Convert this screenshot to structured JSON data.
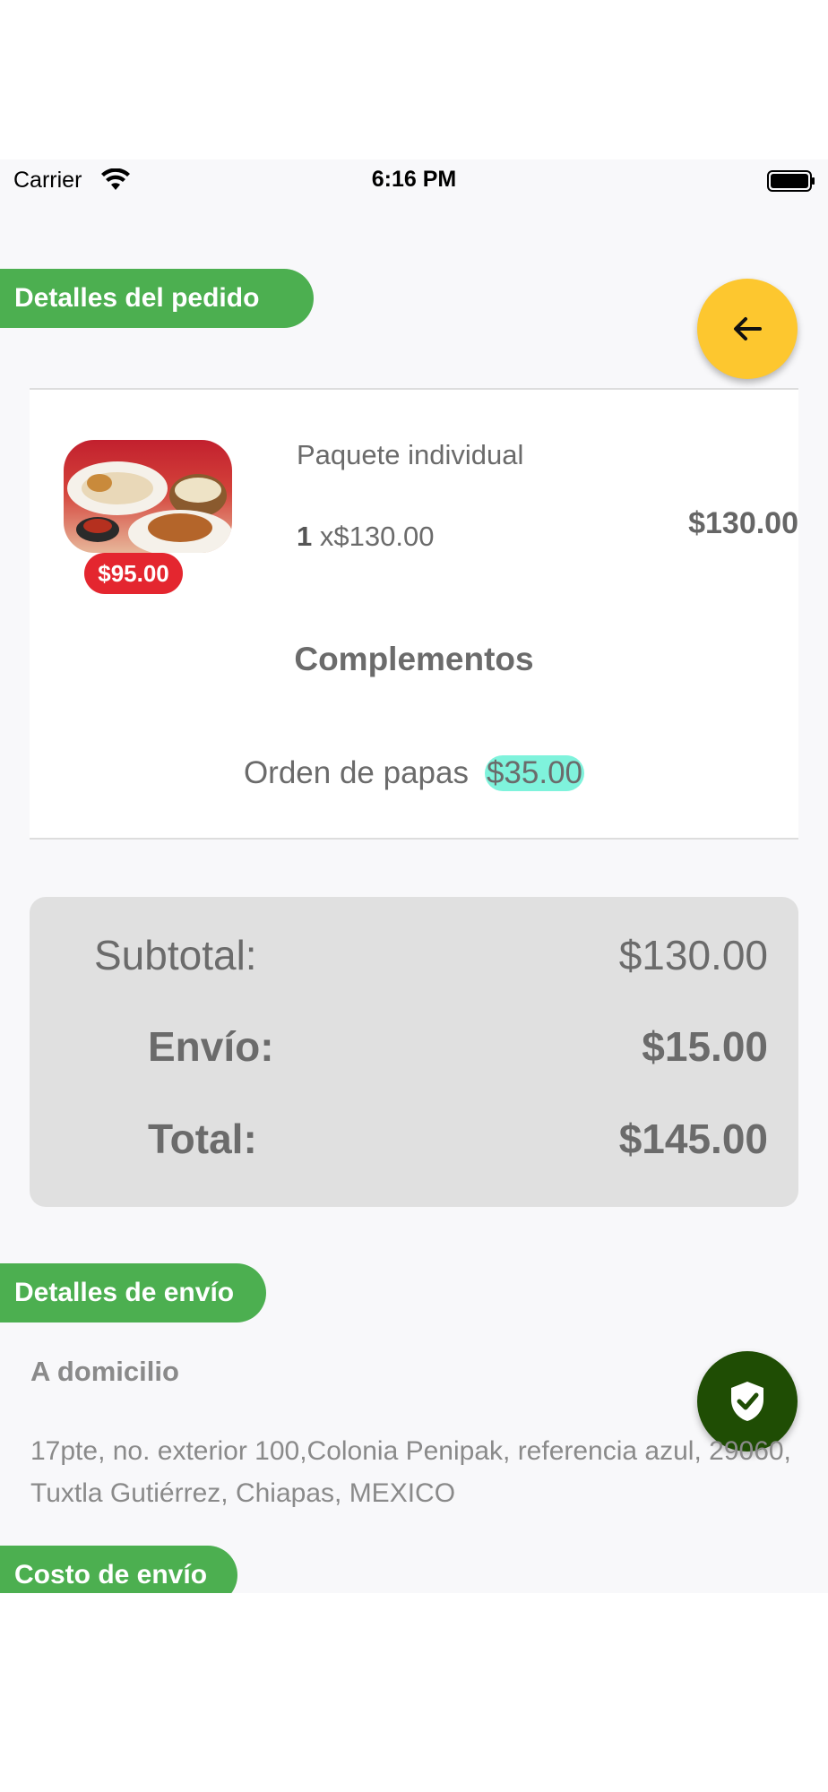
{
  "status_bar": {
    "carrier": "Carrier",
    "time": "6:16 PM"
  },
  "order_section": {
    "title": "Detalles del pedido"
  },
  "product": {
    "badge_price": "$95.00",
    "name": "Paquete individual",
    "quantity": "1",
    "unit_price": "x$130.00",
    "total": "$130.00"
  },
  "complements": {
    "title": "Complementos",
    "items": [
      {
        "name": "Orden de papas",
        "price": "$35.00"
      }
    ]
  },
  "totals": {
    "subtotal_label": "Subtotal:",
    "subtotal_value": "$130.00",
    "shipping_label": "Envío:",
    "shipping_value": "$15.00",
    "total_label": "Total:",
    "total_value": "$145.00"
  },
  "shipping_section": {
    "title": "Detalles de envío",
    "type": "A domicilio",
    "address": "17pte, no. exterior 100,Colonia Penipak, referencia azul, 29060, Tuxtla Gutiérrez, Chiapas, MEXICO"
  },
  "shipping_cost_section": {
    "title": "Costo de envío"
  },
  "colors": {
    "section_pill": "#4caf50",
    "back_button": "#fdc72f",
    "secure_button": "#1f4d04",
    "badge": "#e4262f",
    "complement_highlight": "#7ff3dc"
  },
  "icons": {
    "back": "arrow-left-icon",
    "secure": "shield-check-icon",
    "wifi": "wifi-icon",
    "battery": "battery-icon"
  }
}
